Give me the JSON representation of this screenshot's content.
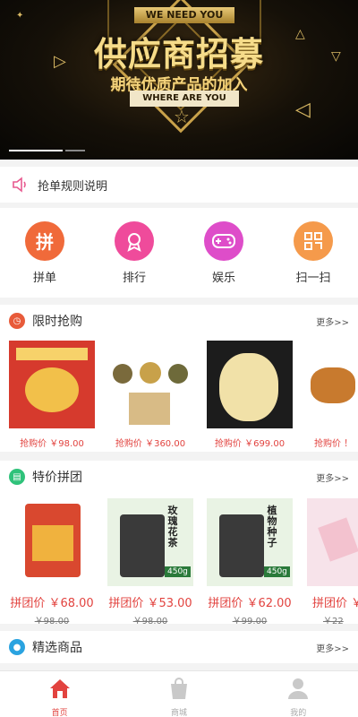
{
  "banner": {
    "top_ribbon": "WE NEED YOU",
    "title": "供应商招募",
    "subtitle": "期待优质产品的加入",
    "bottom_ribbon": "WHERE ARE YOU"
  },
  "notice": {
    "text": "抢单规则说明",
    "icon": "speaker-icon"
  },
  "categories": [
    {
      "label": "拼单",
      "glyph": "拼",
      "icon": "pin-icon",
      "color": "#f06a3a"
    },
    {
      "label": "排行",
      "glyph": "♙",
      "icon": "ribbon-medal-icon",
      "color": "#ef4b9b"
    },
    {
      "label": "娱乐",
      "glyph": "✚",
      "icon": "gamepad-icon",
      "color": "#de4dc9"
    },
    {
      "label": "扫一扫",
      "glyph": "▦",
      "icon": "scan-icon",
      "color": "#f59a4b"
    }
  ],
  "flash_sale": {
    "title": "限时抢购",
    "more": "更多>>",
    "items": [
      {
        "price": "抢购价 ￥98.00"
      },
      {
        "price": "抢购价 ￥360.00"
      },
      {
        "price": "抢购价 ￥699.00"
      },
      {
        "price": "抢购价 ！"
      }
    ]
  },
  "group_buy": {
    "title": "特价拼团",
    "more": "更多>>",
    "items": [
      {
        "price": "拼团价 ￥68.00",
        "orig": "￥98.00"
      },
      {
        "price": "拼团价 ￥53.00",
        "orig": "￥98.00",
        "tag": "玫瑰花茶",
        "badge": "450g"
      },
      {
        "price": "拼团价 ￥62.00",
        "orig": "￥99.00",
        "tag": "植物种子",
        "badge": "450g"
      },
      {
        "price": "拼团价 ￥",
        "orig": "￥22"
      }
    ]
  },
  "selected": {
    "title": "精选商品",
    "more": "更多>>"
  },
  "tabbar": [
    {
      "label": "首页",
      "icon": "home-icon",
      "active": true
    },
    {
      "label": "商城",
      "icon": "shopping-bag-icon",
      "active": false
    },
    {
      "label": "我的",
      "icon": "user-icon",
      "active": false
    }
  ],
  "colors": {
    "accent": "#e2433f"
  }
}
